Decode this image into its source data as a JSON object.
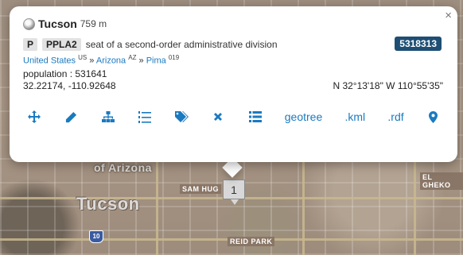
{
  "map": {
    "city_label": "Tucson",
    "university_label": "of Arizona",
    "street_sam_hughes": "SAM HUG",
    "street_reid_park": "REID PARK",
    "street_el_gheko": "EL GHEKO",
    "highway_shield": "10",
    "cluster_count": "1"
  },
  "popup": {
    "place_name": "Tucson",
    "elevation": "759 m",
    "feature_class": "P",
    "feature_code": "PPLA2",
    "feature_description": "seat of a second-order administrative division",
    "geoname_id": "5318313",
    "hierarchy": [
      {
        "name": "United States",
        "code": "US"
      },
      {
        "name": "Arizona",
        "code": "AZ"
      },
      {
        "name": "Pima",
        "code": "019"
      }
    ],
    "hierarchy_separator": "»",
    "population_line": "population : 531641",
    "decimal_coords": "32.22174, -110.92648",
    "dms_coords": "N 32°13'18\" W 110°55'35\"",
    "close_label": "×"
  },
  "toolbar": {
    "icons": [
      "move-icon",
      "pencil-icon",
      "hierarchy-icon",
      "list-numbered-icon",
      "tags-icon",
      "times-icon",
      "list-icon",
      "map-marker-icon"
    ],
    "geotree_label": "geotree",
    "kml_label": ".kml",
    "rdf_label": ".rdf"
  },
  "colors": {
    "link": "#1a7ac0",
    "id_badge": "#1e4e74",
    "gray_badge": "#e2e2e2"
  }
}
